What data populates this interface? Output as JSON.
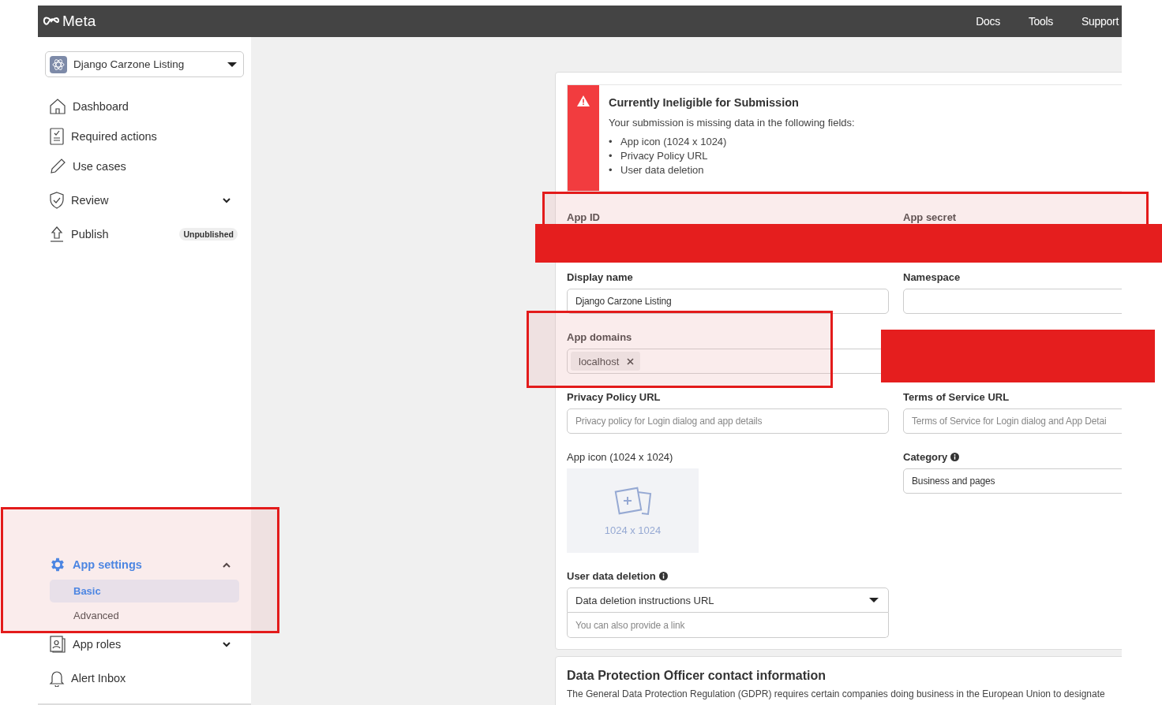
{
  "topbar": {
    "logo": "Meta",
    "links": [
      "Docs",
      "Tools",
      "Support"
    ]
  },
  "sidebar": {
    "app_selector": "Django Carzone Listing",
    "items": [
      {
        "label": "Dashboard",
        "selected": false
      },
      {
        "label": "Required actions",
        "selected": false
      },
      {
        "label": "Use cases",
        "selected": false
      },
      {
        "label": "Review",
        "selected": false,
        "expanded": false
      },
      {
        "label": "Publish",
        "selected": false,
        "badge": "Unpublished"
      },
      {
        "label": "App settings",
        "selected": true,
        "expanded": true,
        "children": [
          {
            "label": "Basic",
            "selected": true
          },
          {
            "label": "Advanced",
            "selected": false
          }
        ]
      },
      {
        "label": "App roles",
        "selected": false,
        "expanded": false
      },
      {
        "label": "Alert Inbox",
        "selected": false
      }
    ]
  },
  "alert": {
    "title": "Currently Ineligible for Submission",
    "message": "Your submission is missing data in the following fields:",
    "bullet": "•",
    "missing_fields": [
      "App icon (1024 x 1024)",
      "Privacy Policy URL",
      "User data deletion"
    ]
  },
  "fields": [
    {
      "label": "App ID",
      "kind": "covered"
    },
    {
      "label": "App secret",
      "kind": "covered"
    },
    {
      "label": "Display name",
      "kind": "text",
      "value": "Django Carzone Listing"
    },
    {
      "label": "Namespace",
      "kind": "text"
    },
    {
      "label": "App domains",
      "kind": "tags",
      "tags": [
        "localhost"
      ]
    },
    {
      "label": "Privacy Policy URL",
      "kind": "text",
      "placeholder": "Privacy policy for Login dialog and app details"
    },
    {
      "label": "Terms of Service URL",
      "kind": "text",
      "placeholder": "Terms of Service for Login dialog and App Detai"
    },
    {
      "label": "App icon (1024 x 1024)",
      "kind": "image",
      "caption": "1024 x 1024"
    },
    {
      "label": "Category",
      "kind": "text",
      "info": true,
      "value": "Business and pages"
    },
    {
      "label": "User data deletion",
      "kind": "select",
      "info": true,
      "value": "Data deletion instructions URL",
      "placeholder": "You can also provide a link"
    }
  ],
  "dpo": {
    "title": "Data Protection Officer contact information",
    "text": "The General Data Protection Regulation (GDPR) requires certain companies doing business in the European Union to designate"
  }
}
